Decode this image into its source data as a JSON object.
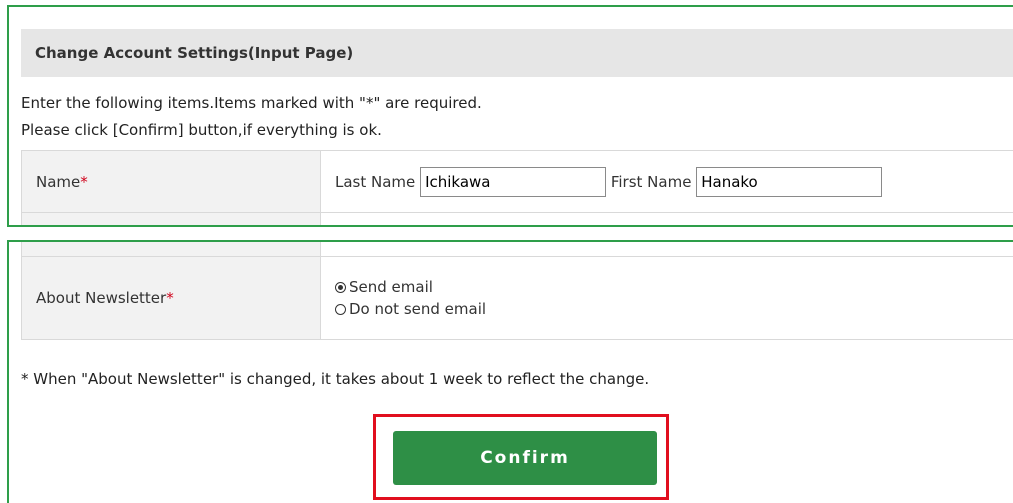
{
  "header": {
    "title": "Change Account Settings(Input Page)"
  },
  "instructions": {
    "line1": "Enter the following items.Items marked with \"*\" are required.",
    "line2": "Please click [Confirm] button,if everything is ok."
  },
  "name_row": {
    "label": "Name",
    "required_mark": "*",
    "last_name_label": "Last Name",
    "last_name_value": "Ichikawa",
    "first_name_label": "First Name",
    "first_name_value": "Hanako"
  },
  "newsletter_row": {
    "label": "About Newsletter",
    "required_mark": "*",
    "options": [
      {
        "label": "Send email",
        "selected": true
      },
      {
        "label": "Do not send email",
        "selected": false
      }
    ]
  },
  "note": "* When \"About Newsletter\" is changed, it takes about 1 week to reflect the change.",
  "confirm_label": "Confirm",
  "colors": {
    "panel_border": "#2e9e4a",
    "button": "#2e8f46",
    "highlight": "#e10e1e",
    "required": "#d0021b"
  }
}
